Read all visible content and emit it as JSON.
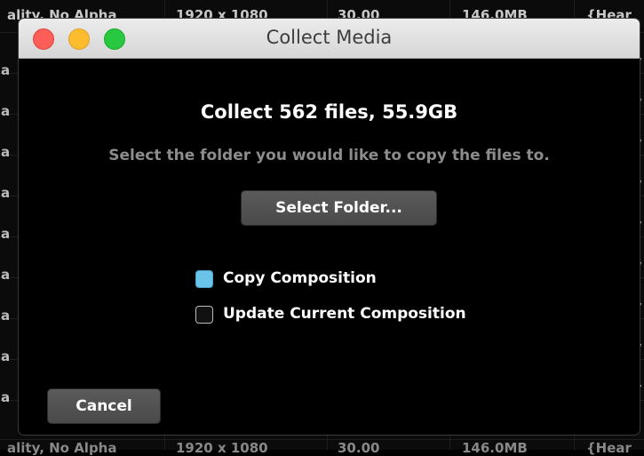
{
  "background": {
    "top_row_cells": [
      "ality, No Alpha",
      "1920 x 1080",
      "30.00",
      "146.0MB",
      "{Hear"
    ],
    "bottom_row_cells": [
      "ality, No Alpha",
      "1920 x 1080",
      "30.00",
      "146.0MB",
      "{Hear"
    ],
    "left_edge_glyph": "a",
    "right_edge_glyph": "/"
  },
  "window": {
    "title": "Collect Media",
    "controls": {
      "close_color": "#fd5e57",
      "minimize_color": "#fdbc2e",
      "zoom_color": "#28c840"
    }
  },
  "dialog": {
    "heading": "Collect 562 files, 55.9GB",
    "subtitle": "Select the folder you would like to copy the files to.",
    "select_folder_label": "Select Folder...",
    "options": [
      {
        "label": "Copy Composition",
        "checked": true
      },
      {
        "label": "Update Current Composition",
        "checked": false
      }
    ],
    "cancel_label": "Cancel"
  },
  "colors": {
    "checkbox_checked": "#6ac3e8",
    "dialog_background": "#000000",
    "button_background": "#525252"
  }
}
